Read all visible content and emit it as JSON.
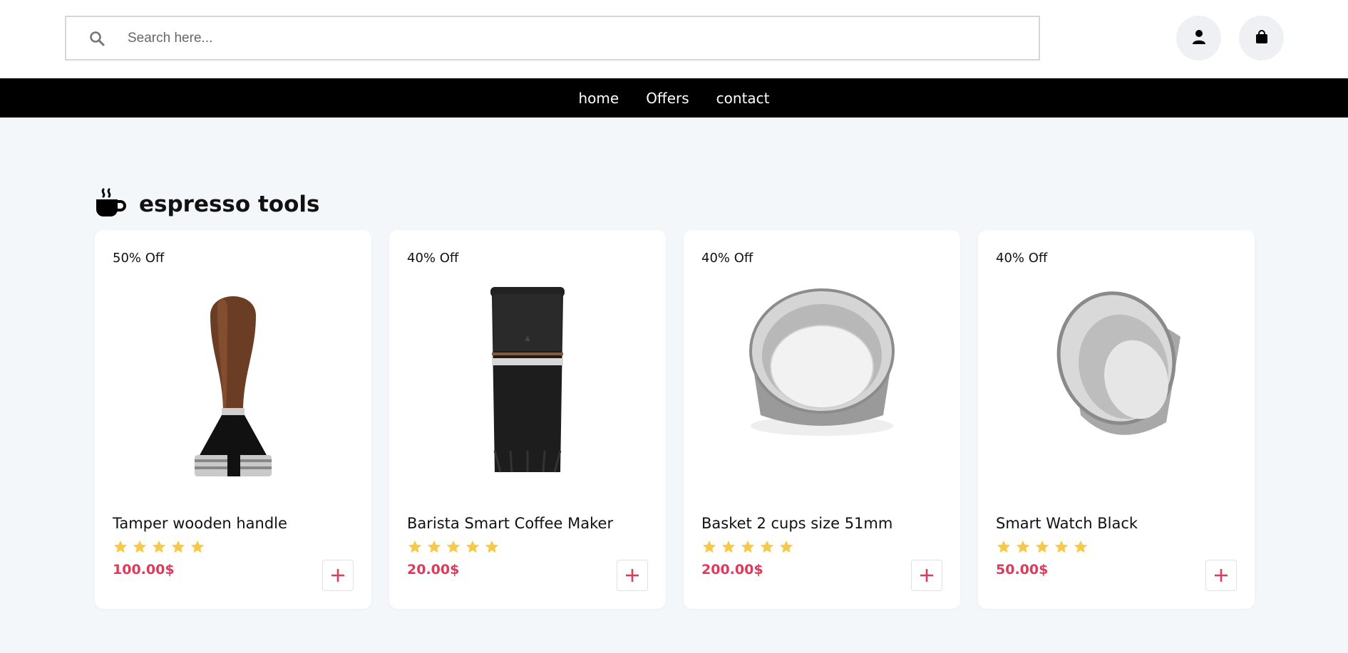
{
  "search": {
    "placeholder": "Search here..."
  },
  "header": {
    "user_icon": "user-icon",
    "bag_icon": "shopping-bag-icon"
  },
  "nav": {
    "items": [
      {
        "label": "home"
      },
      {
        "label": "Offers"
      },
      {
        "label": "contact"
      }
    ]
  },
  "section": {
    "title": "espresso tools",
    "icon": "coffee-cup-icon"
  },
  "products": [
    {
      "discount": "50% Off",
      "name": "Tamper wooden handle",
      "rating": 5,
      "price": "100.00$",
      "image": "tamper"
    },
    {
      "discount": "40% Off",
      "name": "Barista Smart Coffee Maker",
      "rating": 5,
      "price": "20.00$",
      "image": "grinder"
    },
    {
      "discount": "40% Off",
      "name": "Basket 2 cups size 51mm",
      "rating": 5,
      "price": "200.00$",
      "image": "basket"
    },
    {
      "discount": "40% Off",
      "name": "Smart Watch Black",
      "rating": 5,
      "price": "50.00$",
      "image": "filter"
    }
  ],
  "colors": {
    "accent_price": "#e03a5a",
    "star": "#f7c948",
    "navbar": "#000000",
    "page_bg": "#f4f7fa"
  }
}
